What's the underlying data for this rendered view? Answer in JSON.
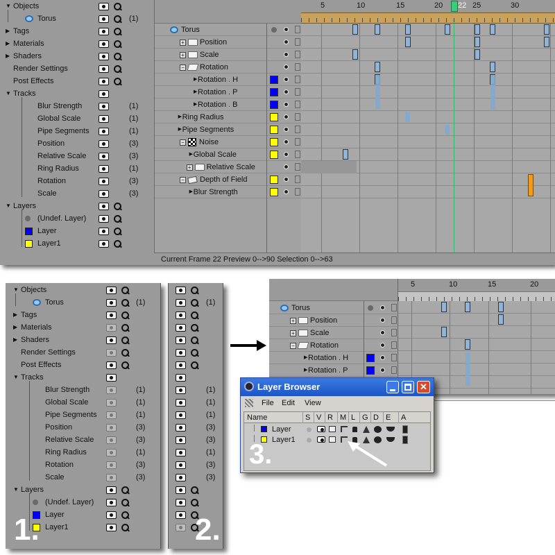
{
  "panel1": {
    "rows": [
      {
        "label": "Objects",
        "count": "",
        "kind": "group",
        "mag": true
      },
      {
        "label": "Torus",
        "count": "(1)",
        "kind": "torus",
        "mag": true
      },
      {
        "label": "Tags",
        "count": "",
        "kind": "group",
        "mag": true
      },
      {
        "label": "Materials",
        "count": "",
        "kind": "group",
        "mag": true
      },
      {
        "label": "Shaders",
        "count": "",
        "kind": "group",
        "mag": true
      },
      {
        "label": "Render Settings",
        "count": "",
        "kind": "plain",
        "mag": true
      },
      {
        "label": "Post Effects",
        "count": "",
        "kind": "plain",
        "mag": true
      },
      {
        "label": "Tracks",
        "count": "",
        "kind": "group",
        "mag": false
      },
      {
        "label": "Blur Strength",
        "count": "(1)",
        "kind": "track",
        "mag": false
      },
      {
        "label": "Global Scale",
        "count": "(1)",
        "kind": "track",
        "mag": false
      },
      {
        "label": "Pipe Segments",
        "count": "(1)",
        "kind": "track",
        "mag": false
      },
      {
        "label": "Position",
        "count": "(3)",
        "kind": "track",
        "mag": false
      },
      {
        "label": "Relative Scale",
        "count": "(3)",
        "kind": "track",
        "mag": false
      },
      {
        "label": "Ring Radius",
        "count": "(1)",
        "kind": "track",
        "mag": false
      },
      {
        "label": "Rotation",
        "count": "(3)",
        "kind": "track",
        "mag": false
      },
      {
        "label": "Scale",
        "count": "(3)",
        "kind": "track",
        "mag": false
      },
      {
        "label": "Layers",
        "count": "",
        "kind": "group",
        "mag": true
      },
      {
        "label": "(Undef. Layer)",
        "count": "",
        "kind": "undef",
        "mag": true
      },
      {
        "label": "Layer",
        "count": "",
        "kind": "layer-blue",
        "mag": true
      },
      {
        "label": "Layer1",
        "count": "",
        "kind": "layer-yellow",
        "mag": true
      }
    ]
  },
  "timeline_top": {
    "ruler": [
      "5",
      "10",
      "15",
      "20",
      "22",
      "25",
      "30"
    ],
    "tracks": [
      "Torus",
      "Position",
      "Scale",
      "Rotation",
      "Rotation . H",
      "Rotation . P",
      "Rotation . B",
      "Ring Radius",
      "Pipe Segments",
      "Noise",
      "Global Scale",
      "Relative Scale",
      "Depth of Field",
      "Blur Strength"
    ],
    "status": "Current Frame  22  Preview  0-->90    Selection 0-->63"
  },
  "label_1": "1.",
  "label_2": "2.",
  "label_3": "3.",
  "timeline_small": {
    "ruler": [
      "5",
      "10",
      "15",
      "20"
    ],
    "tracks": [
      "Torus",
      "Position",
      "Scale",
      "Rotation",
      "Rotation . H",
      "Rotation . P"
    ]
  },
  "layer_browser": {
    "title": "Layer Browser",
    "menu": [
      "File",
      "Edit",
      "View"
    ],
    "columns": [
      "Name",
      "S",
      "V",
      "R",
      "M",
      "L",
      "G",
      "D",
      "E",
      "A"
    ],
    "rows": [
      "Layer",
      "Layer1"
    ]
  },
  "colors": {
    "blue": "#0000ff",
    "yellow": "#ffff00",
    "panel": "#9a9a9a",
    "key": "#8fb4d8",
    "cursor": "#3ccb78"
  }
}
